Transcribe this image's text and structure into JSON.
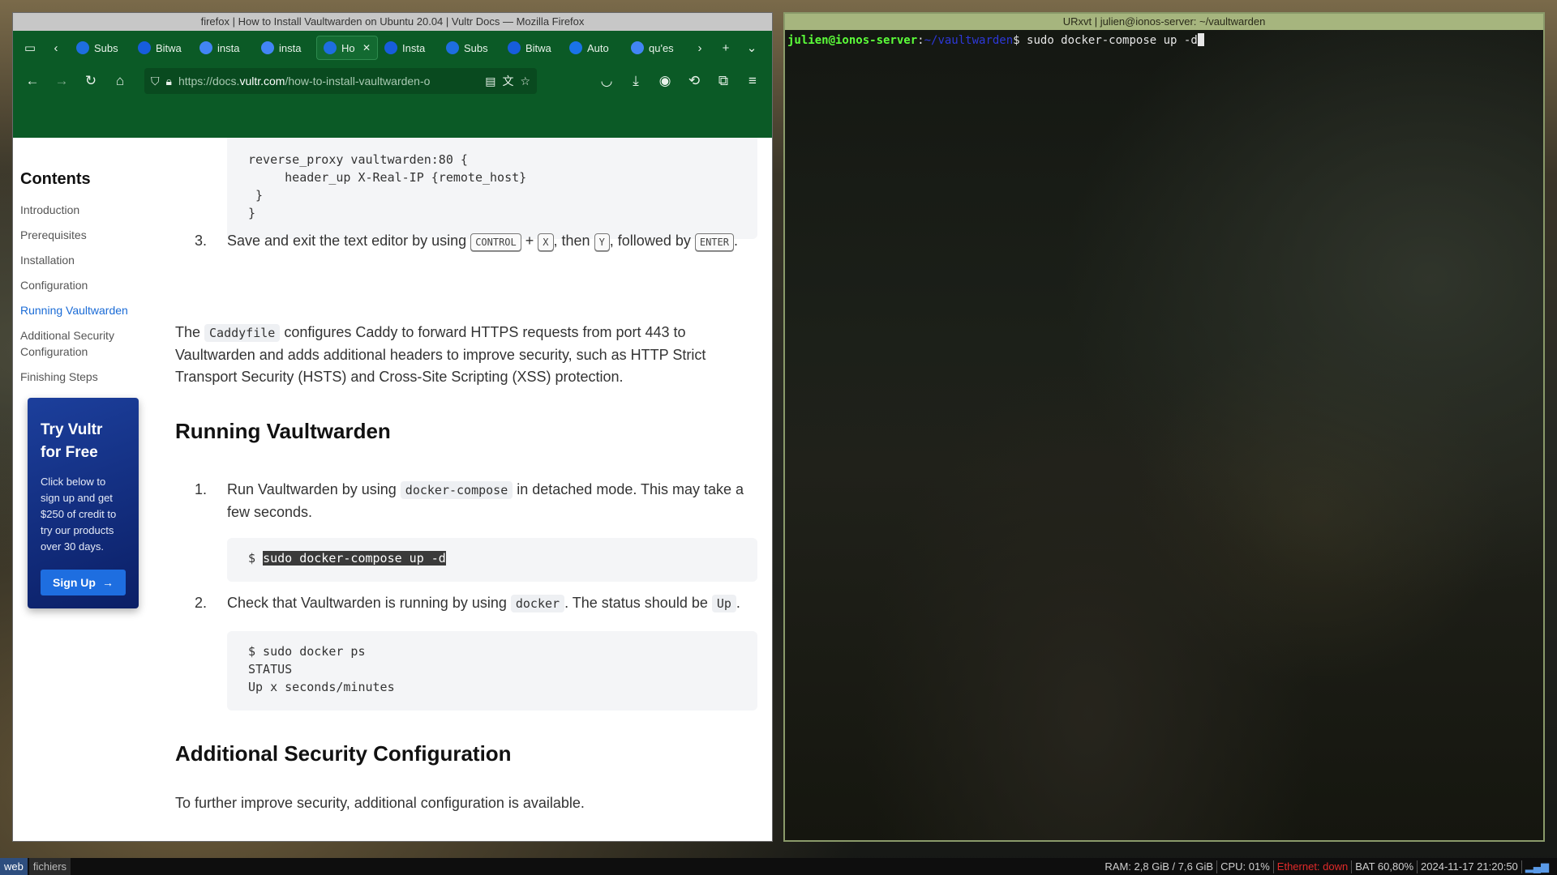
{
  "firefox": {
    "window_title": "firefox | How to Install Vaultwarden on Ubuntu 20.04 | Vultr Docs — Mozilla Firefox",
    "tabs": [
      {
        "label": "Subs",
        "icon": "vultr-icon",
        "color": "#1e6ee0"
      },
      {
        "label": "Bitwa",
        "icon": "bitwarden-icon",
        "color": "#175ddc"
      },
      {
        "label": "insta",
        "icon": "google-icon",
        "color": "#4285f4"
      },
      {
        "label": "insta",
        "icon": "google-icon",
        "color": "#4285f4"
      },
      {
        "label": "Ho",
        "icon": "vultr-icon",
        "color": "#1e6ee0",
        "active": true
      },
      {
        "label": "Insta",
        "icon": "bitwarden-icon",
        "color": "#175ddc"
      },
      {
        "label": "Subs",
        "icon": "vultr-icon",
        "color": "#1e6ee0"
      },
      {
        "label": "Bitwa",
        "icon": "bitwarden-icon",
        "color": "#175ddc"
      },
      {
        "label": "Auto",
        "icon": "it-icon",
        "color": "#1a73e8"
      },
      {
        "label": "qu'es",
        "icon": "google-icon",
        "color": "#4285f4"
      }
    ],
    "url_prefix": "https://docs.",
    "url_domain": "vultr.com",
    "url_suffix": "/how-to-install-vaultwarden-o",
    "accent": "#0b5a26"
  },
  "toc": {
    "title": "Contents",
    "items": [
      {
        "label": "Introduction"
      },
      {
        "label": "Prerequisites"
      },
      {
        "label": "Installation"
      },
      {
        "label": "Configuration"
      },
      {
        "label": "Running Vaultwarden",
        "active": true
      },
      {
        "label": "Additional Security Configuration"
      },
      {
        "label": "Finishing Steps"
      }
    ],
    "promo": {
      "title": "Try Vultr for Free",
      "body": "Click below to sign up and get $250 of credit to try our products over 30 days.",
      "button": "Sign Up"
    }
  },
  "article": {
    "code_top": "reverse_proxy vaultwarden:80 {\n     header_up X-Real-IP {remote_host}\n }\n}",
    "step3": {
      "num": "3.",
      "t1": "Save and exit the text editor by using ",
      "k1": "CONTROL",
      "plus": " + ",
      "k2": "X",
      "t2": ", then ",
      "k3": "Y",
      "t3": ", followed by ",
      "k4": "ENTER",
      "t4": "."
    },
    "caddy_para": {
      "t1": "The ",
      "code": "Caddyfile",
      "t2": " configures Caddy to forward HTTPS requests from port 443 to Vaultwarden and adds additional headers to improve security, such as HTTP Strict Transport Security (HSTS) and Cross-Site Scripting (XSS) protection."
    },
    "h_running": "Running Vaultwarden",
    "run1": {
      "num": "1.",
      "t1": "Run Vaultwarden by using ",
      "code": "docker-compose",
      "t2": " in detached mode. This may take a few seconds."
    },
    "run1_code_prompt": "$ ",
    "run1_code_cmd": "sudo docker-compose up -d",
    "run2": {
      "num": "2.",
      "t1": "Check that Vaultwarden is running by using ",
      "code1": "docker",
      "t2": ". The status should be ",
      "code2": "Up",
      "t3": "."
    },
    "run2_code": "$ sudo docker ps\nSTATUS\nUp x seconds/minutes",
    "h_security": "Additional Security Configuration",
    "security_para": "To further improve security, additional configuration is available."
  },
  "terminal": {
    "title": "URxvt | julien@ionos-server: ~/vaultwarden",
    "user": "julien@ionos-server",
    "sep": ":",
    "path": "~/vaultwarden",
    "prompt": "$ ",
    "command": "sudo docker-compose up -d"
  },
  "taskbar": {
    "workspaces": [
      "web",
      "fichiers"
    ],
    "ram": "RAM: 2,8 GiB / 7,6 GiB",
    "cpu": "CPU: 01%",
    "ethernet": "Ethernet: down",
    "battery": "BAT 60,80%",
    "datetime": "2024-11-17 21:20:50"
  }
}
